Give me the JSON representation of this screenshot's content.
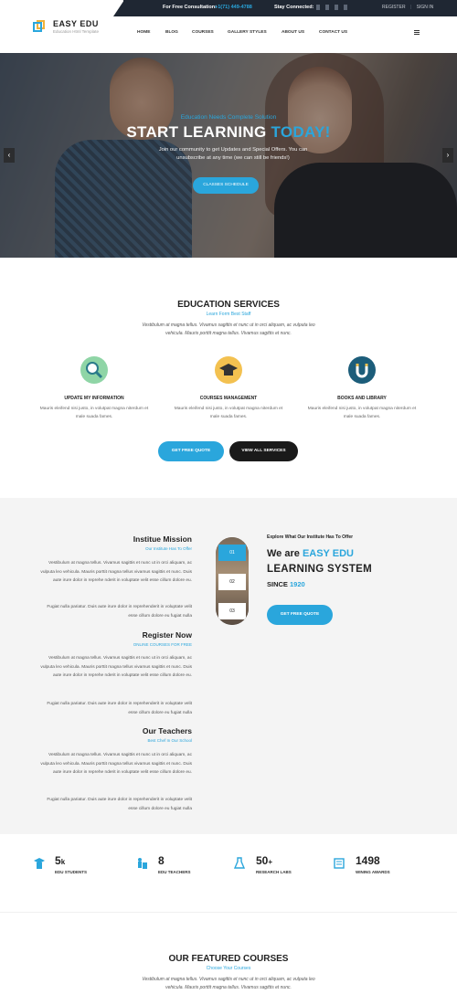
{
  "topbar": {
    "consultation_label": "For Free Consultation:",
    "phone": "+1(71) 449-4788",
    "stay_connected": "Stay Connected:",
    "register": "REGISTER",
    "sign_in": "SIGN IN"
  },
  "brand": {
    "title": "EASY EDU",
    "subtitle": "Education Html Template"
  },
  "nav": {
    "items": [
      "HOME",
      "BLOG",
      "COURSES",
      "GALLERY STYLES",
      "ABOUT US",
      "CONTACT US"
    ]
  },
  "hero": {
    "pretitle": "Education Needs Complete Solution",
    "title_main": "START LEARNING ",
    "title_highlight": "TODAY!",
    "description": "Join our community to get Updates and Special Offers. You can unsubscribe at any time (we can still be friends!)",
    "button": "CLASSES SCHEDULE",
    "prev_arrow": "‹",
    "next_arrow": "›"
  },
  "services": {
    "title": "EDUCATION SERVICES",
    "subtitle": "Learn Form Best Staff",
    "description": "Vestibulum at magna tellus. Vivamus sagittis et nunc ut in orci aliquam, ac vulputa leo vehicula. Mauris porttit magna tellus. Vivamus sagittis et nunc.",
    "items": [
      {
        "title": "UPDATE MY INFORMATION",
        "text": "Mauris eleifend nisi justo, in volutpat magna niterdum et male suada fames."
      },
      {
        "title": "COURSES MANAGEMENT",
        "text": "Mauris eleifend nisi justo, in volutpat magna niterdum et male suada fames."
      },
      {
        "title": "BOOKS AND LIBRARY",
        "text": "Mauris eleifend nisi justo, in volutpat magna niterdum et male suada fames."
      }
    ],
    "btn_quote": "GET FREE QUOTE",
    "btn_all": "VIEW ALL SERVICES"
  },
  "mission": {
    "blocks": [
      {
        "title": "Institue Mission",
        "subtitle": "Our Institute Has To Offer",
        "p1": "Vestibulum at magna tellus. Vivamus sagittis et nunc ut in orci aliquam, ac vulputa leo vehicula. Mauris porttit magna tellus vivamus sagittis et nunc. Duis aute irure dolor in reprehe nderit in voluptate velit esse cillum dolore eu.",
        "p2": "Fugiat nulla pariatur. Duis aute irure dolor in reprehenderit in voluptate velit esse cillum dolore eu fugiat nulla"
      },
      {
        "title": "Register Now",
        "subtitle": "ONLINE COURSES FOR FREE",
        "p1": "Vestibulum at magna tellus. Vivamus sagittis et nunc ut in orci aliquam, ac vulputa leo vehicula. Mauris porttit magna tellus vivamus sagittis et nunc. Duis aute irure dolor in reprehe nderit in voluptate velit esse cillum dolore eu.",
        "p2": "Fugiat nulla pariatur. Duis aute irure dolor in reprehenderit in voluptate velit esse cillum dolore eu fugiat nulla"
      },
      {
        "title": "Our Teachers",
        "subtitle": "Best Chef In Our School",
        "p1": "Vestibulum at magna tellus. Vivamus sagittis et nunc ut in orci aliquam, ac vulputa leo vehicula. Mauris porttit magna tellus vivamus sagittis et nunc. Duis aute irure dolor in reprehe nderit in voluptate velit esse cillum dolore eu.",
        "p2": "Fugiat nulla pariatur. Duis aute irure dolor in reprehenderit in voluptate velit esse cillum dolore eu fugiat nulla"
      }
    ],
    "steps": [
      "01",
      "02",
      "03"
    ],
    "right_pre": "Explore What Our Institute Has To Offer",
    "right_we_are": "We are ",
    "right_brand": "EASY EDU",
    "right_system": "LEARNING SYSTEM",
    "right_since": "SINCE ",
    "right_year": "1920",
    "right_button": "GET FREE QUOTE"
  },
  "stats": [
    {
      "number": "5",
      "suffix": "k",
      "label": "EDU STUDENTS",
      "icon": "graduate-icon"
    },
    {
      "number": "8",
      "suffix": "",
      "label": "EDU TEACHERS",
      "icon": "teacher-icon"
    },
    {
      "number": "50",
      "suffix": "+",
      "label": "RESEARCH LABS",
      "icon": "flask-icon"
    },
    {
      "number": "1498",
      "suffix": "",
      "label": "WINING AWARDS",
      "icon": "certificate-icon"
    }
  ],
  "featured": {
    "title": "OUR FEATURED COURSES",
    "subtitle": "Choose Your Courses",
    "description": "Vestibulum at magna tellus. Vivamus sagittis et nunc ut in orci aliquam, ac vulputa leo vehicula. Mauris porttit magna tellus. Vivamus sagittis et nunc."
  },
  "colors": {
    "accent": "#2aa6dc",
    "dark": "#1f2733",
    "yellow": "#f0b33a"
  }
}
